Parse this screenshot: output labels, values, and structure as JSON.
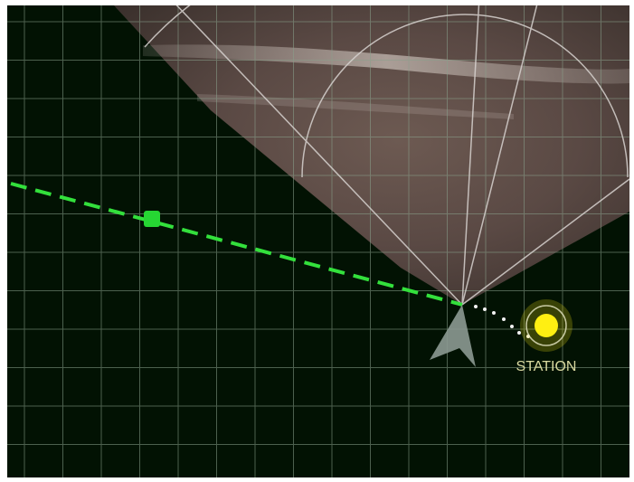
{
  "station": {
    "label": "STATION",
    "color": "#ffef12"
  },
  "colors": {
    "background": "#021203",
    "grid": "#8aa18c",
    "route": "#33e03c",
    "waypoint": "#26d633",
    "sonar_rays": "#d7d2cf",
    "vessel": "#8c9a92"
  },
  "icons": {
    "vessel": "vessel-arrow-icon",
    "waypoint": "waypoint-square-icon",
    "station": "station-marker-icon"
  }
}
